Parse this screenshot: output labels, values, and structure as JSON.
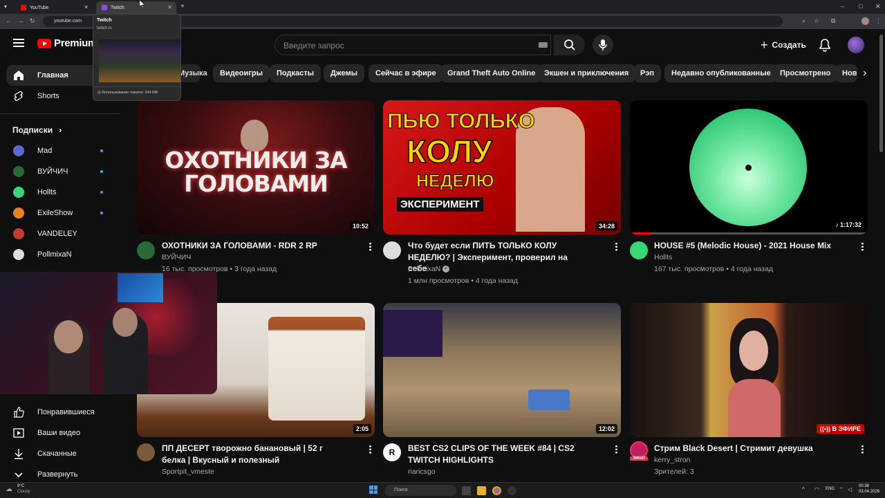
{
  "browser": {
    "tabs": [
      {
        "label": "YouTube"
      },
      {
        "label": "Twitch"
      }
    ],
    "url": "youtube.com"
  },
  "tab_preview": {
    "title": "Twitch",
    "url": "twitch.tv",
    "memory": "Использование памяти: 344 МБ"
  },
  "header": {
    "logo": "Premium",
    "search_placeholder": "Введите запрос",
    "create_label": "Создать"
  },
  "chips": [
    "Музыка",
    "Видеоигры",
    "Подкасты",
    "Джемы",
    "Сейчас в эфире",
    "Grand Theft Auto Online",
    "Экшен и приключения",
    "Рэп",
    "Недавно опубликованные",
    "Просмотрено",
    "Нов"
  ],
  "sidebar": {
    "main": [
      {
        "label": "Главная",
        "icon": "home-icon"
      },
      {
        "label": "Shorts",
        "icon": "shorts-icon"
      }
    ],
    "subs_heading": "Подписки",
    "subs": [
      {
        "label": "Mad",
        "color": "#5a6ad0"
      },
      {
        "label": "ВУЙЧИЧ",
        "color": "#2a6a3a"
      },
      {
        "label": "Hollts",
        "color": "#38d878"
      },
      {
        "label": "ExileShow",
        "color": "#e88020"
      },
      {
        "label": "VANDELEY",
        "color": "#c04030"
      },
      {
        "label": "PollmixaN",
        "color": "#dddddd"
      }
    ],
    "bottom": [
      {
        "label": "Понравившиеся",
        "icon": "thumb-up-icon"
      },
      {
        "label": "Ваши видео",
        "icon": "video-icon"
      },
      {
        "label": "Скачанные",
        "icon": "download-icon"
      },
      {
        "label": "Развернуть",
        "icon": "chevron-down-icon"
      }
    ]
  },
  "videos": [
    {
      "title": "ОХОТНИКИ ЗА ГОЛОВАМИ - RDR 2 RP",
      "channel": "ВУЙЧИЧ",
      "meta": "16 тыс. просмотров • 3 года назад",
      "duration": "10:52",
      "thumb_text": "ОХОТНИКИ ЗА ГОЛОВАМИ"
    },
    {
      "title": "Что будет если ПИТЬ ТОЛЬКО КОЛУ НЕДЕЛЮ? | Эксперимент, проверил на себе",
      "channel": "PollmixaN",
      "meta": "1 млн просмотров • 4 года назад",
      "duration": "34:28",
      "thumb_text_1": "ПЬЮ ТОЛЬКО",
      "thumb_text_2": "КОЛУ",
      "thumb_text_3": "НЕДЕЛЮ",
      "thumb_text_4": "ЭКСПЕРИМЕНТ"
    },
    {
      "title": "HOUSE #5 (Melodic House) - 2021 House Mix",
      "channel": "Hollts",
      "meta": "167 тыс. просмотров • 4 года назад",
      "duration": "1:17:32",
      "progress": 0.09
    },
    {
      "title": "ПП ДЕСЕРТ творожно банановый | 52 г белка | Вкусный и полезный",
      "channel": "Sportpit_vmeste",
      "meta": "",
      "duration": "2:05"
    },
    {
      "title": "BEST CS2 CLIPS OF THE WEEK #84 | CS2 TWITCH HIGHLIGHTS",
      "channel": "riaricsgo",
      "meta": "",
      "duration": "12:02"
    },
    {
      "title": "Стрим Black Desert | Стримит девушка",
      "channel": "kerry_stron",
      "meta": "Зрителей: 3",
      "live_badge": "В ЭФИРЕ",
      "avatar_badge": "ЭФИР"
    }
  ],
  "taskbar": {
    "weather_temp": "9°C",
    "weather_text": "Cloudy",
    "search": "Поиск",
    "lang": "ENG",
    "time": "00:38",
    "date": "03.04.2026"
  }
}
